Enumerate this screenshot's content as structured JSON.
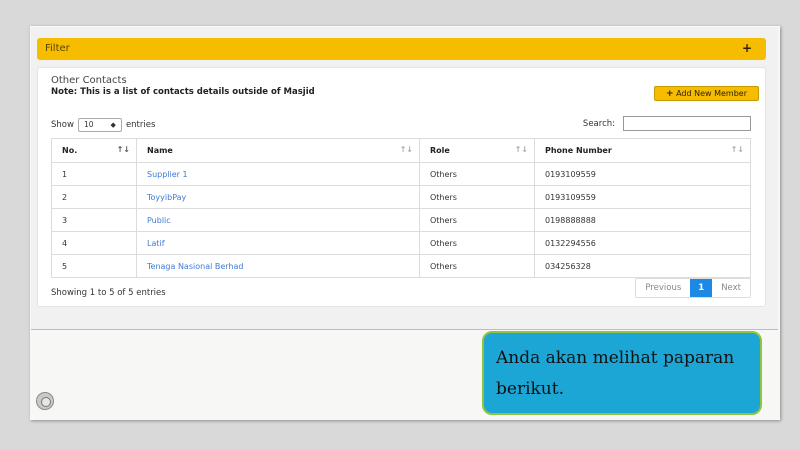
{
  "filter": {
    "title": "Filter",
    "toggle": "+"
  },
  "contacts": {
    "title": "Other Contacts",
    "note": "Note: This is a list of contacts details outside of Masjid",
    "add_button": {
      "icon": "+",
      "label": "Add New Member"
    }
  },
  "table_controls": {
    "show_label": "Show",
    "entries_value": "10",
    "entries_label": "entries",
    "search_label": "Search:"
  },
  "table": {
    "columns": [
      "No.",
      "Name",
      "Role",
      "Phone Number"
    ],
    "rows": [
      [
        "1",
        "Supplier 1",
        "Others",
        "0193109559"
      ],
      [
        "2",
        "ToyyibPay",
        "Others",
        "0193109559"
      ],
      [
        "3",
        "Public",
        "Others",
        "0198888888"
      ],
      [
        "4",
        "Latif",
        "Others",
        "0132294556"
      ],
      [
        "5",
        "Tenaga Nasional Berhad",
        "Others",
        "034256328"
      ]
    ]
  },
  "footer": {
    "info": "Showing 1 to 5 of 5 entries",
    "prev": "Previous",
    "page": "1",
    "next": "Next"
  },
  "callout": {
    "text": "Anda akan melihat paparan berikut."
  },
  "colors": {
    "accent": "#f6bd00",
    "link": "#3d7bd6",
    "callout_bg": "#1ba6d6",
    "callout_border": "#8fc43e",
    "page_active": "#1e88e5"
  }
}
